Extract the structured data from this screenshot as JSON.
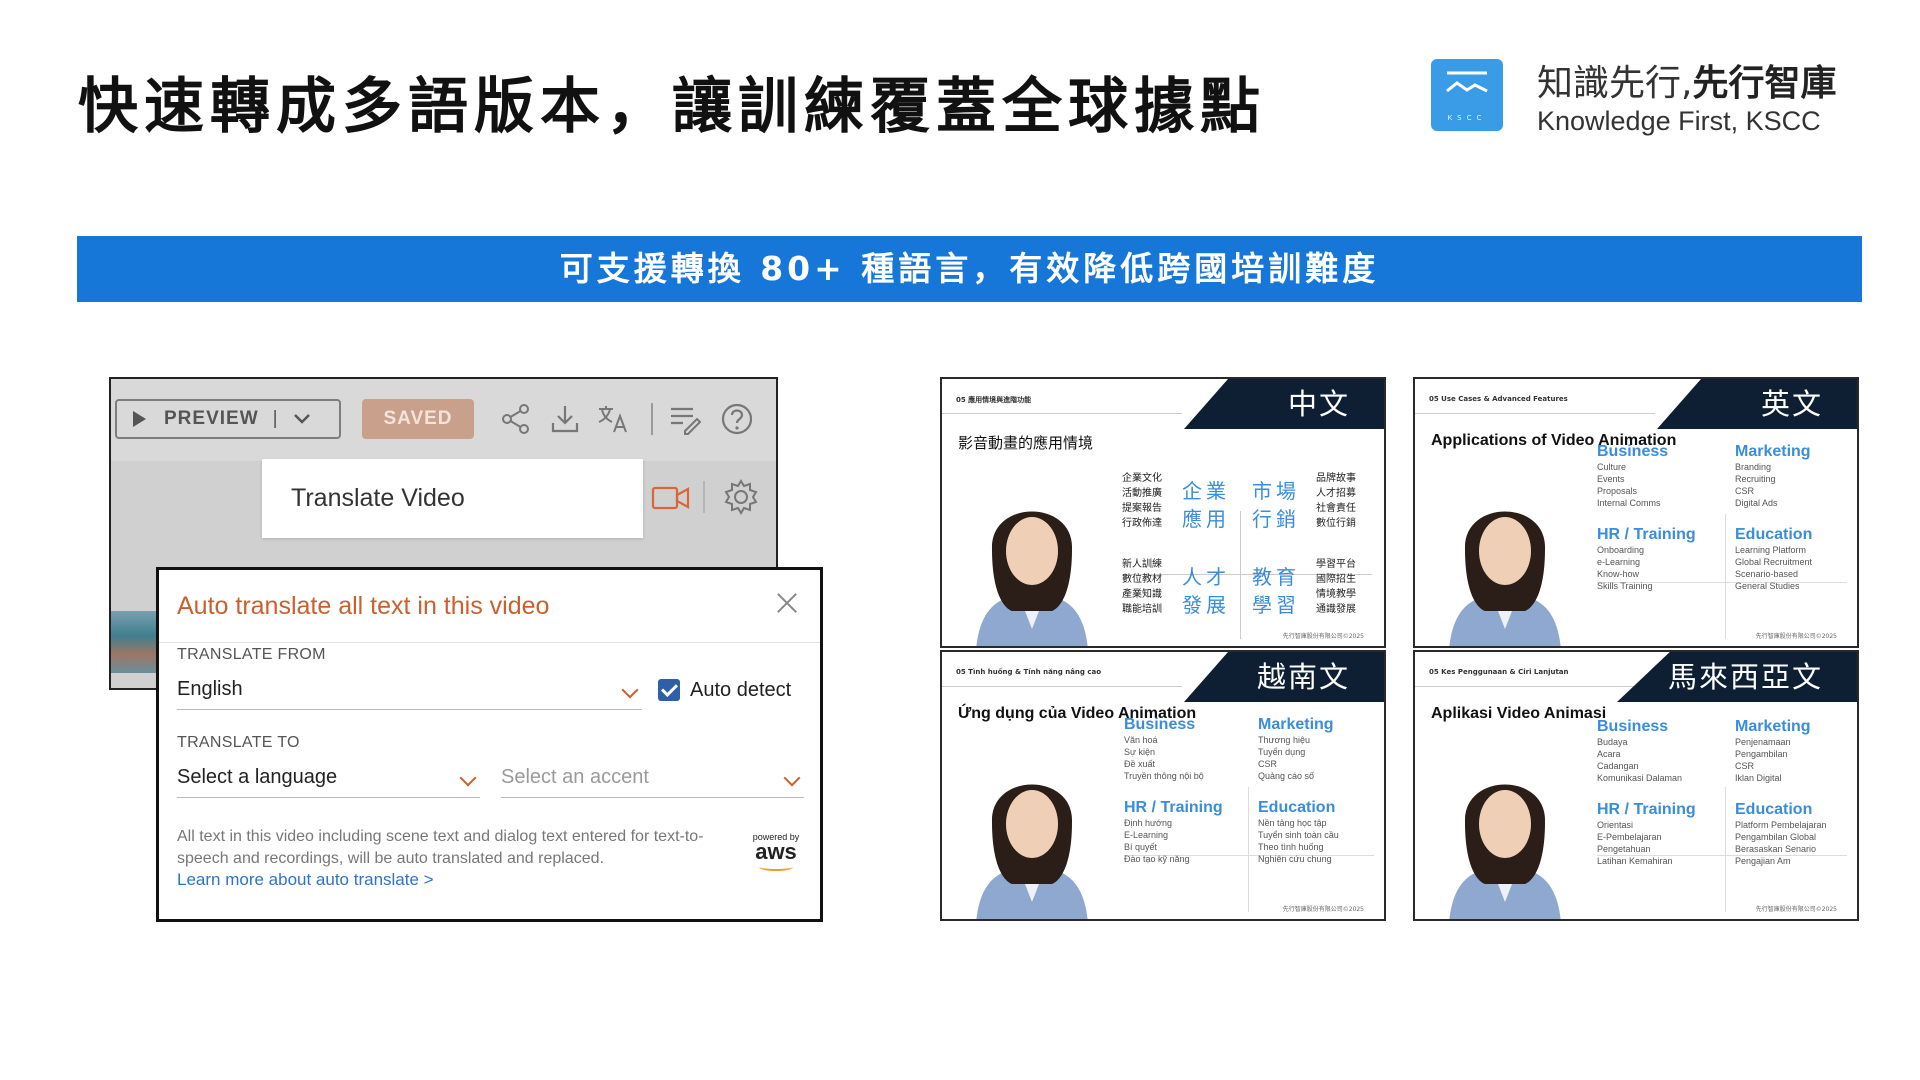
{
  "header": {
    "title": "快速轉成多語版本，讓訓練覆蓋全球據點",
    "brand_zh_light": "知識先行,",
    "brand_zh_bold": "先行智庫",
    "brand_en": "Knowledge First, KSCC",
    "logo_text": "KSCC"
  },
  "banner": {
    "text": "可支援轉換 80+ 種語言，有效降低跨國培訓難度"
  },
  "app": {
    "toolbar": {
      "preview_label": "PREVIEW",
      "preview_sep": "|",
      "saved_label": "SAVED",
      "icons": [
        "share-icon",
        "download-icon",
        "translate-icon",
        "script-edit-icon",
        "help-icon"
      ]
    },
    "menu": {
      "translate_video": "Translate Video"
    },
    "dialog": {
      "title": "Auto translate all text in this video",
      "from_label": "TRANSLATE FROM",
      "from_value": "English",
      "auto_detect": "Auto detect",
      "auto_detect_checked": true,
      "to_label": "TRANSLATE TO",
      "language_placeholder": "Select a language",
      "accent_placeholder": "Select an accent",
      "note": "All text in this video including scene text and dialog text entered for text-to-speech and recordings, will be auto translated and replaced.",
      "learn_more": "Learn more about auto translate >",
      "powered_by": "powered by",
      "aws": "aws"
    }
  },
  "thumbnails": {
    "zh": {
      "tag": "中文",
      "crumb": "05 應用情境與進階功能",
      "title": "影音動畫的應用情境",
      "cats": [
        {
          "small": [
            "企業文化",
            "活動推廣",
            "提案報告",
            "行政佈達"
          ],
          "big": [
            "企業",
            "應用"
          ]
        },
        {
          "small": [
            "品牌故事",
            "人才招募",
            "社會責任",
            "數位行銷"
          ],
          "big": [
            "市場",
            "行銷"
          ]
        },
        {
          "small": [
            "新人訓練",
            "數位教材",
            "產業知識",
            "職能培訓"
          ],
          "big": [
            "人才",
            "發展"
          ]
        },
        {
          "small": [
            "學習平台",
            "國際招生",
            "情境教學",
            "通識發展"
          ],
          "big": [
            "教育",
            "學習"
          ]
        }
      ],
      "copyright": "先行智庫股份有限公司©2025"
    },
    "en": {
      "tag": "英文",
      "crumb": "05 Use Cases & Advanced Features",
      "title": "Applications of Video Animation",
      "cats": [
        {
          "h": "Business",
          "items": [
            "Culture",
            "Events",
            "Proposals",
            "Internal Comms"
          ]
        },
        {
          "h": "Marketing",
          "items": [
            "Branding",
            "Recruiting",
            "CSR",
            "Digital Ads"
          ]
        },
        {
          "h": "HR / Training",
          "items": [
            "Onboarding",
            "e-Learning",
            "Know-how",
            "Skills Training"
          ]
        },
        {
          "h": "Education",
          "items": [
            "Learning Platform",
            "Global Recruitment",
            "Scenario-based",
            "General Studies"
          ]
        }
      ],
      "copyright": "先行智庫股份有限公司©2025"
    },
    "vi": {
      "tag": "越南文",
      "crumb": "05 Tình huống & Tính năng nâng cao",
      "title": "Ứng dụng của Video Animation",
      "cats": [
        {
          "h": "Business",
          "items": [
            "Văn hoá",
            "Sự kiện",
            "Đề xuất",
            "Truyền thông nội bộ"
          ]
        },
        {
          "h": "Marketing",
          "items": [
            "Thương hiệu",
            "Tuyển dụng",
            "CSR",
            "Quảng cáo số"
          ]
        },
        {
          "h": "HR / Training",
          "items": [
            "Định hướng",
            "E-Learning",
            "Bí quyết",
            "Đào tạo kỹ năng"
          ]
        },
        {
          "h": "Education",
          "items": [
            "Nền tảng học tập",
            "Tuyển sinh toàn cầu",
            "Theo tình huống",
            "Nghiên cứu chung"
          ]
        }
      ],
      "copyright": "先行智庫股份有限公司©2025"
    },
    "ms": {
      "tag": "馬來西亞文",
      "crumb": "05 Kes Penggunaan & Ciri Lanjutan",
      "title": "Aplikasi Video Animasi",
      "cats": [
        {
          "h": "Business",
          "items": [
            "Budaya",
            "Acara",
            "Cadangan",
            "Komunikasi Dalaman"
          ]
        },
        {
          "h": "Marketing",
          "items": [
            "Penjenamaan",
            "Pengambilan",
            "CSR",
            "Iklan Digital"
          ]
        },
        {
          "h": "HR / Training",
          "items": [
            "Orientasi",
            "E-Pembelajaran",
            "Pengetahuan",
            "Latihan Kemahiran"
          ]
        },
        {
          "h": "Education",
          "items": [
            "Platform Pembelajaran",
            "Pengambilan Global",
            "Berasaskan Senario",
            "Pengajian Am"
          ]
        }
      ],
      "copyright": "先行智庫股份有限公司©2025"
    }
  }
}
